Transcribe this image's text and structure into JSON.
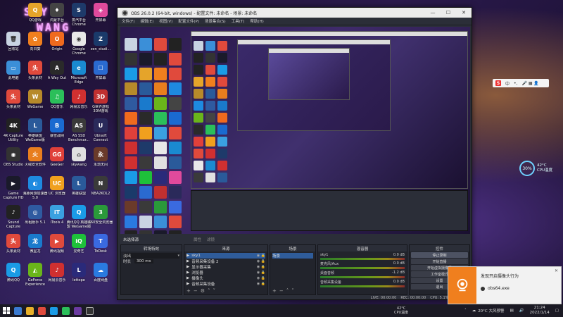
{
  "desktop": {
    "logo_line1": "SKY",
    "logo_line2": "WANG",
    "icons": [
      {
        "label": "回收站",
        "color": "#c9d4e2",
        "glyph": "🗑",
        "col": 0,
        "row": 1
      },
      {
        "label": "此电脑",
        "color": "#3b8fd8",
        "glyph": "▭",
        "col": 0,
        "row": 2
      },
      {
        "label": "头条素材",
        "color": "#e04a3c",
        "glyph": "头",
        "col": 0,
        "row": 3
      },
      {
        "label": "4K Capture Utility",
        "color": "#222",
        "glyph": "4K",
        "col": 0,
        "row": 4
      },
      {
        "label": "OBS Studio",
        "color": "#333",
        "glyph": "◉",
        "col": 0,
        "row": 5
      },
      {
        "label": "Game Capture HD",
        "color": "#1a1a2a",
        "glyph": "▶",
        "col": 0,
        "row": 6
      },
      {
        "label": "Sound Capture",
        "color": "#222",
        "glyph": "♪",
        "col": 0,
        "row": 7
      },
      {
        "label": "头条素材",
        "color": "#e04a3c",
        "glyph": "头",
        "col": 0,
        "row": 8
      },
      {
        "label": "腾讯QQ",
        "color": "#1a9be6",
        "glyph": "Q",
        "col": 0,
        "row": 9
      },
      {
        "label": "QQ游戏",
        "color": "#e5a42a",
        "glyph": "Q",
        "col": 1,
        "row": 0
      },
      {
        "label": "向日葵",
        "color": "#f07f1e",
        "glyph": "✿",
        "col": 1,
        "row": 1
      },
      {
        "label": "头条素材",
        "color": "#e04a3c",
        "glyph": "头",
        "col": 1,
        "row": 2
      },
      {
        "label": "WeGame",
        "color": "#b78a2a",
        "glyph": "W",
        "col": 1,
        "row": 3
      },
      {
        "label": "英雄联盟 WeGame版",
        "color": "#2a5a9a",
        "glyph": "L",
        "col": 1,
        "row": 4
      },
      {
        "label": "火绒安全软件",
        "color": "#e87e1e",
        "glyph": "火",
        "col": 1,
        "row": 5
      },
      {
        "label": "海豚网游加速器5.0",
        "color": "#1e8ae0",
        "glyph": "◐",
        "col": 1,
        "row": 6
      },
      {
        "label": "出租射手 5.1",
        "color": "#2f5aa0",
        "glyph": "◎",
        "col": 1,
        "row": 7
      },
      {
        "label": "微星龙",
        "color": "#1a7acc",
        "glyph": "龙",
        "col": 1,
        "row": 8
      },
      {
        "label": "GeForce Experience",
        "color": "#6ab51a",
        "glyph": "◭",
        "col": 1,
        "row": 9
      },
      {
        "label": "鸿蒙平台",
        "color": "#444",
        "glyph": "♦",
        "col": 2,
        "row": 0
      },
      {
        "label": "Origin",
        "color": "#f06a1e",
        "glyph": "O",
        "col": 2,
        "row": 1
      },
      {
        "label": "A Way Out",
        "color": "#2a2a2a",
        "glyph": "A",
        "col": 2,
        "row": 2
      },
      {
        "label": "QQ音乐",
        "color": "#2bbf5a",
        "glyph": "♫",
        "col": 2,
        "row": 3
      },
      {
        "label": "暴雪战网",
        "color": "#1a6ad0",
        "glyph": "B",
        "col": 2,
        "row": 4
      },
      {
        "label": "GeeGer",
        "color": "#e0403a",
        "glyph": "GG",
        "col": 2,
        "row": 5
      },
      {
        "label": "UC 浏览器",
        "color": "#f0a01e",
        "glyph": "UC",
        "col": 2,
        "row": 6
      },
      {
        "label": "iTools 4",
        "color": "#3aa0e0",
        "glyph": "iT",
        "col": 2,
        "row": 7
      },
      {
        "label": "腾讯视频",
        "color": "#e04a3c",
        "glyph": "▶",
        "col": 2,
        "row": 8
      },
      {
        "label": "网易云音乐",
        "color": "#d03030",
        "glyph": "♪",
        "col": 2,
        "row": 9
      },
      {
        "label": "蒸汽平台 Chrome",
        "color": "#1e3a6a",
        "glyph": "S",
        "col": 3,
        "row": 0
      },
      {
        "label": "Google Chrome",
        "color": "#e8e8e8",
        "glyph": "◉",
        "col": 3,
        "row": 1
      },
      {
        "label": "Microsoft Edge",
        "color": "#1a8ad0",
        "glyph": "e",
        "col": 3,
        "row": 2
      },
      {
        "label": "网易云音乐",
        "color": "#d03030",
        "glyph": "♪",
        "col": 3,
        "row": 3
      },
      {
        "label": "AS SSD Benchmar...",
        "color": "#3a3a3a",
        "glyph": "AS",
        "col": 3,
        "row": 4
      },
      {
        "label": "skywang",
        "color": "#e0e0e0",
        "glyph": "⌂",
        "col": 3,
        "row": 5
      },
      {
        "label": "英雄联盟",
        "color": "#2a5a9a",
        "glyph": "L",
        "col": 3,
        "row": 6
      },
      {
        "label": "腾讯QQ 英雄联盟 WeGame版",
        "color": "#1a9be6",
        "glyph": "Q",
        "col": 3,
        "row": 7
      },
      {
        "label": "爱奇艺",
        "color": "#1ec03a",
        "glyph": "iQ",
        "col": 3,
        "row": 8
      },
      {
        "label": "lettope",
        "color": "#2a2a7a",
        "glyph": "L",
        "col": 3,
        "row": 9
      },
      {
        "label": "开屏幕",
        "color": "#e04a9c",
        "glyph": "◈",
        "col": 4,
        "row": 0
      },
      {
        "label": "zen_studi...",
        "color": "#1a3a6a",
        "glyph": "Z",
        "col": 4,
        "row": 1
      },
      {
        "label": "开屏幕",
        "color": "#2a6ad0",
        "glyph": "☐",
        "col": 4,
        "row": 2
      },
      {
        "label": "G世界游戏 3DM游戏",
        "color": "#c03030",
        "glyph": "3D",
        "col": 4,
        "row": 3
      },
      {
        "label": "Ubisoft Connect",
        "color": "#2a2a5a",
        "glyph": "U",
        "col": 4,
        "row": 4
      },
      {
        "label": "永劫无间",
        "color": "#6a3a2a",
        "glyph": "永",
        "col": 4,
        "row": 5
      },
      {
        "label": "NBA2KOL2",
        "color": "#3a3a3a",
        "glyph": "N",
        "col": 4,
        "row": 6
      },
      {
        "label": "360安全浏览器",
        "color": "#2a9a3a",
        "glyph": "3",
        "col": 4,
        "row": 7
      },
      {
        "label": "ToDesk",
        "color": "#3a6ae0",
        "glyph": "T",
        "col": 4,
        "row": 8
      },
      {
        "label": "百度网盘",
        "color": "#2a7ae0",
        "glyph": "☁",
        "col": 4,
        "row": 9
      }
    ]
  },
  "obs": {
    "title": "OBS 26.0.2 (64-bit, windows) - 配置文件: 未命名 - 场景: 未命名",
    "menu": [
      "文件(F)",
      "编辑(E)",
      "视图(V)",
      "配置文件(P)",
      "场景集合(S)",
      "工具(T)",
      "帮助(H)"
    ],
    "dock_tabs": {
      "tab1": "未选择源",
      "tab2": "属性",
      "tab3": "滤镜"
    },
    "transitions": {
      "header": "转场特效",
      "type": "淡出",
      "duration_label": "时长",
      "duration_value": "300 ms"
    },
    "sources": {
      "header": "来源",
      "items": [
        "sky1",
        "音频采集设备 2",
        "显示器采集",
        "浏览器",
        "摄像头",
        "音频采集设备"
      ]
    },
    "scenes": {
      "header": "场景",
      "items": [
        "场景"
      ]
    },
    "mixer": {
      "header": "混音器",
      "channels": [
        {
          "name": "sky1",
          "db": "0.0 dB"
        },
        {
          "name": "麦克风/Aux",
          "db": "0.0 dB"
        },
        {
          "name": "桌面音频",
          "db": "-1.2 dB"
        },
        {
          "name": "音频采集设备",
          "db": "0.0 dB"
        }
      ]
    },
    "controls": {
      "header": "控件",
      "buttons": [
        "停止录制",
        "开始直播",
        "开始虚拟摄像机",
        "工作室模式",
        "设置",
        "退出"
      ],
      "active": "停止录制"
    },
    "status": {
      "live": "LIVE: 00:00:00",
      "rec": "REC: 00:00:00",
      "cpu": "CPU: 5.1%, 30.00 fps"
    }
  },
  "overlays": {
    "ime": {
      "brand": "S",
      "lang": "中",
      "punct": "•,",
      "icons": "🎤 ▦ 👤"
    },
    "cpu_widget": {
      "percent": "30%",
      "temp": "42°C",
      "label": "CPU温度"
    },
    "toast": {
      "title": "发现开启摄像头行为",
      "app": "obs64.exe",
      "close": "✕",
      "accent": "#f07f1e"
    }
  },
  "taskbar": {
    "temp_value": "42°C",
    "temp_label": "CPU温度",
    "weather": "20°C 大风预警",
    "time": "21:24",
    "date": "2022/1/14"
  }
}
